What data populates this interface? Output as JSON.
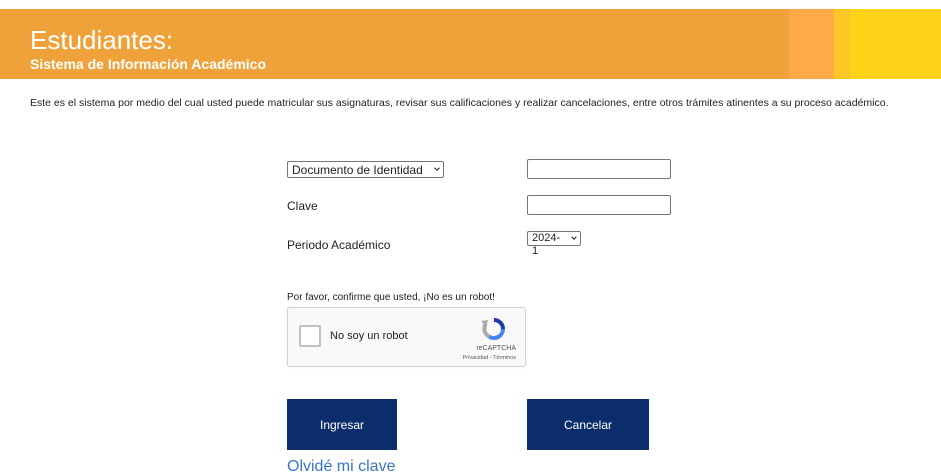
{
  "header": {
    "title": "Estudiantes:",
    "subtitle": "Sistema de Información Académico"
  },
  "intro": "Este es el sistema por medio del cual usted puede matricular sus asignaturas, revisar sus calificaciones y realizar cancelaciones, entre otros trámites atinentes a su proceso académico.",
  "form": {
    "doc_type_selected": "Documento de Identidad",
    "doc_number_value": "",
    "password_label": "Clave",
    "password_value": "",
    "period_label": "Periodo Académico",
    "period_selected": "2024-1"
  },
  "captcha": {
    "prompt": "Por favor, confirme que usted, ¡No es un robot!",
    "checkbox_label": "No soy un robot",
    "brand": "reCAPTCHA",
    "links": "Privacidad - Términos"
  },
  "buttons": {
    "login": "Ingresar",
    "cancel": "Cancelar"
  },
  "forgot_link": "Olvidé mi clave",
  "icons": {
    "select_caret": "chevron-down-icon",
    "captcha_logo": "recaptcha-logo-icon"
  },
  "colors": {
    "header_bg": "#f0a23a",
    "button_bg": "#0c2d6b",
    "link": "#3a74c8"
  }
}
